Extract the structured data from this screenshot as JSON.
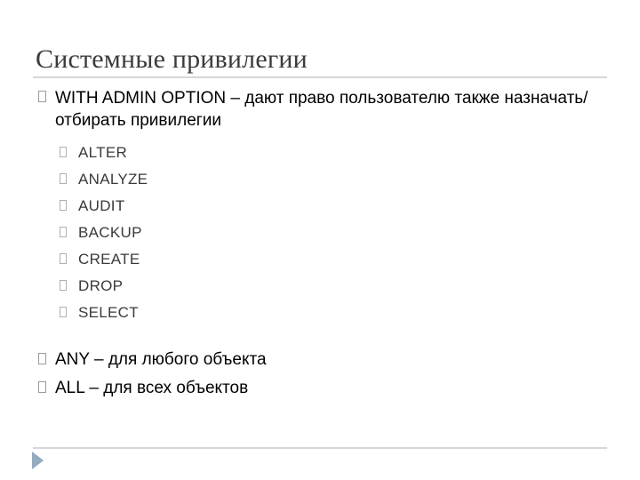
{
  "slide": {
    "title": "Системные привилегии",
    "accent_color": "#93aac0",
    "rule_color": "#d4d8dc",
    "bullet_glyph": "tofu-box",
    "body": {
      "level1": [
        {
          "text": "WITH ADMIN OPTION – дают право  пользователю также назначать/отбирать привилегии"
        }
      ],
      "level2": [
        {
          "text": "ALTER"
        },
        {
          "text": "ANALYZE"
        },
        {
          "text": "AUDIT"
        },
        {
          "text": "BACKUP"
        },
        {
          "text": "CREATE"
        },
        {
          "text": "DROP"
        },
        {
          "text": "SELECT"
        }
      ],
      "level1_tail": [
        {
          "text": "ANY – для любого объекта"
        },
        {
          "text": "ALL – для всех объектов"
        }
      ]
    }
  }
}
